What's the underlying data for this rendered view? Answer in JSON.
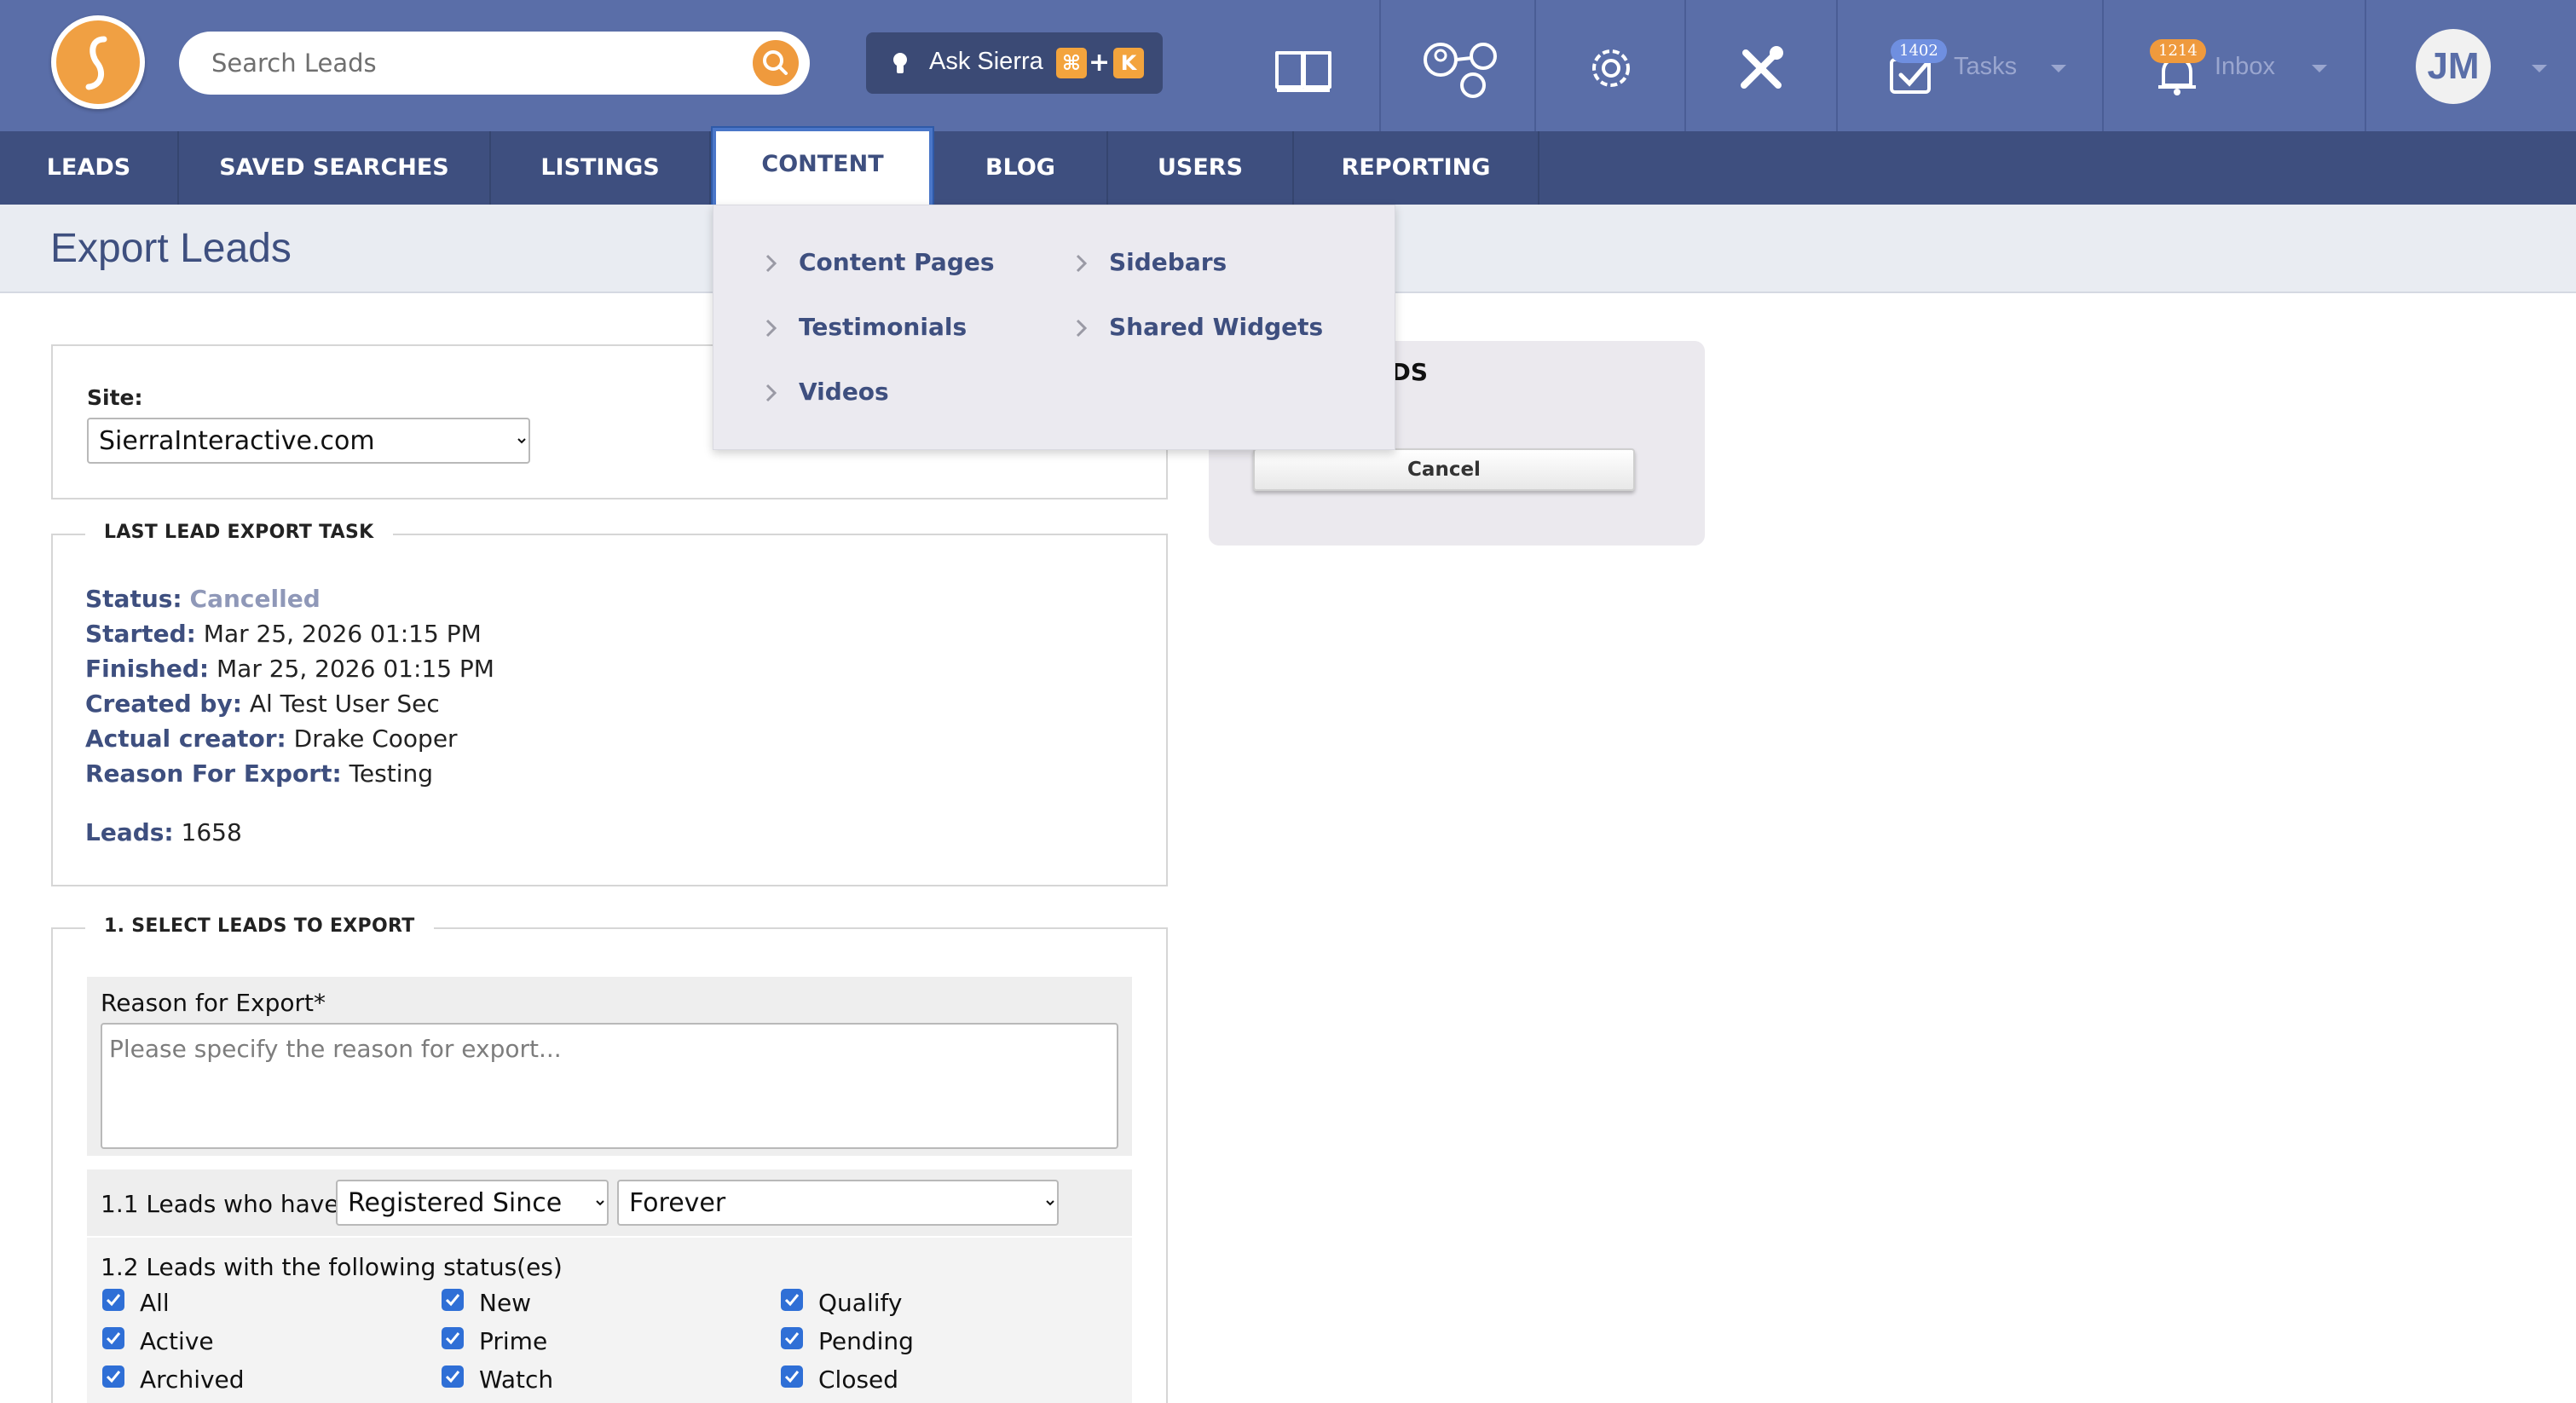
{
  "topbar": {
    "search": {
      "placeholder": "Search Leads"
    },
    "ask": {
      "label": "Ask Sierra",
      "shortcut_key1": "⌘",
      "shortcut_plus": "+",
      "shortcut_key2": "K"
    },
    "tasks": {
      "label": "Tasks",
      "badge": "1402"
    },
    "inbox": {
      "label": "Inbox",
      "badge": "1214"
    },
    "avatar_initials": "JM",
    "colors": {
      "bar": "#5a6ea8",
      "accent": "#ef9a3d",
      "tasks_badge": "#6f8fe0",
      "inbox_badge": "#ef9a3d"
    }
  },
  "nav": {
    "items": [
      {
        "label": "LEADS"
      },
      {
        "label": "SAVED SEARCHES"
      },
      {
        "label": "LISTINGS"
      },
      {
        "label": "CONTENT"
      },
      {
        "label": "BLOG"
      },
      {
        "label": "USERS"
      },
      {
        "label": "REPORTING"
      }
    ],
    "active": "CONTENT"
  },
  "content_menu": {
    "items": [
      {
        "label": "Content Pages"
      },
      {
        "label": "Testimonials"
      },
      {
        "label": "Videos"
      },
      {
        "label": "Sidebars"
      },
      {
        "label": "Shared Widgets"
      }
    ]
  },
  "page": {
    "title": "Export Leads"
  },
  "site": {
    "label": "Site:",
    "selected": "SierraInteractive.com"
  },
  "last_task": {
    "legend": "LAST LEAD EXPORT TASK",
    "status_label": "Status:",
    "status_value": "Cancelled",
    "started_label": "Started:",
    "started_value": "Mar 25, 2026 01:15 PM",
    "finished_label": "Finished:",
    "finished_value": "Mar 25, 2026 01:15 PM",
    "created_by_label": "Created by:",
    "created_by_value": "Al Test User Sec",
    "actual_creator_label": "Actual creator:",
    "actual_creator_value": "Drake Cooper",
    "reason_label": "Reason For Export:",
    "reason_value": "Testing",
    "leads_label": "Leads:",
    "leads_value": "1658"
  },
  "action_panel": {
    "title": "ADS",
    "cancel_label": "Cancel"
  },
  "section1": {
    "legend": "1. SELECT LEADS TO EXPORT",
    "reason_label": "Reason for Export*",
    "reason_placeholder": "Please specify the reason for export...",
    "leads_who_have_label": "1.1 Leads who have",
    "registered_select": "Registered Since",
    "period_select": "Forever",
    "status_label": "1.2 Leads with the following status(es)",
    "statuses": [
      {
        "label": "All",
        "checked": true
      },
      {
        "label": "New",
        "checked": true
      },
      {
        "label": "Qualify",
        "checked": true
      },
      {
        "label": "Active",
        "checked": true
      },
      {
        "label": "Prime",
        "checked": true
      },
      {
        "label": "Pending",
        "checked": true
      },
      {
        "label": "Archived",
        "checked": true
      },
      {
        "label": "Watch",
        "checked": true
      },
      {
        "label": "Closed",
        "checked": true
      }
    ]
  }
}
